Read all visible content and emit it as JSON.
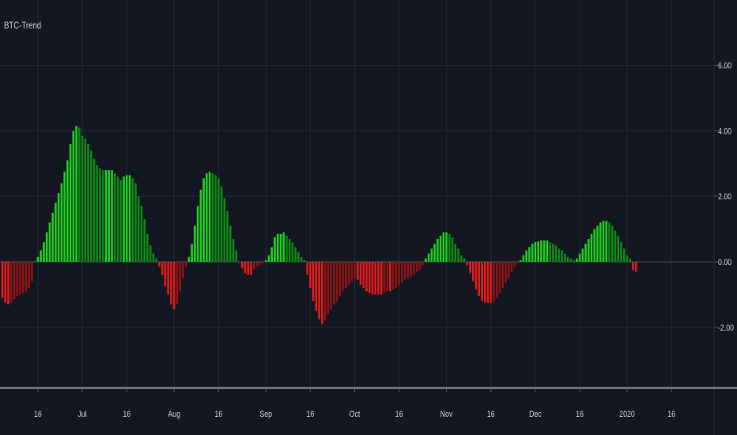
{
  "indicator": {
    "title": "BTC-Trend"
  },
  "colors": {
    "background": "#131722",
    "grid": "#262a36",
    "up_bright": "#1fcf1f",
    "up_dark": "#0e8a12",
    "down_bright": "#e11b1b",
    "down_dark": "#8e1414",
    "axis_text": "#d1d4dc"
  },
  "chart_data": {
    "type": "bar",
    "title": "BTC-Trend",
    "start_date": "2019-06-04",
    "interval": "1 day",
    "ylim": [
      -3.5,
      7.5
    ],
    "grid": true,
    "y_ticks": [
      "6.00",
      "4.00",
      "2.00",
      "0.00",
      "-2.00"
    ],
    "y_tick_values": [
      6,
      4,
      2,
      0,
      -2
    ],
    "x_ticks": [
      {
        "label": "16",
        "date": "2019-06-16"
      },
      {
        "label": "Jul",
        "date": "2019-07-01"
      },
      {
        "label": "16",
        "date": "2019-07-16"
      },
      {
        "label": "Aug",
        "date": "2019-08-01"
      },
      {
        "label": "16",
        "date": "2019-08-16"
      },
      {
        "label": "Sep",
        "date": "2019-09-01"
      },
      {
        "label": "16",
        "date": "2019-09-16"
      },
      {
        "label": "Oct",
        "date": "2019-10-01"
      },
      {
        "label": "16",
        "date": "2019-10-16"
      },
      {
        "label": "Nov",
        "date": "2019-11-01"
      },
      {
        "label": "16",
        "date": "2019-11-16"
      },
      {
        "label": "Dec",
        "date": "2019-12-01"
      },
      {
        "label": "16",
        "date": "2019-12-16"
      },
      {
        "label": "2020",
        "date": "2020-01-01"
      },
      {
        "label": "16",
        "date": "2020-01-16"
      }
    ],
    "values": [
      -1.1,
      -1.25,
      -1.3,
      -1.25,
      -1.15,
      -1.05,
      -1.0,
      -0.95,
      -0.9,
      -0.8,
      -0.6,
      0.02,
      0.15,
      0.35,
      0.6,
      0.9,
      1.2,
      1.5,
      1.8,
      2.1,
      2.4,
      2.75,
      3.1,
      3.6,
      4.0,
      4.15,
      4.1,
      3.85,
      3.75,
      3.6,
      3.4,
      3.15,
      2.95,
      2.85,
      2.8,
      2.8,
      2.8,
      2.8,
      2.7,
      2.6,
      2.5,
      2.6,
      2.65,
      2.65,
      2.55,
      2.4,
      2.0,
      1.7,
      1.3,
      0.85,
      0.5,
      0.25,
      0.1,
      -0.15,
      -0.4,
      -0.75,
      -1.0,
      -1.3,
      -1.45,
      -1.3,
      -0.9,
      -0.5,
      -0.15,
      0.15,
      0.55,
      1.1,
      1.7,
      2.2,
      2.55,
      2.7,
      2.75,
      2.7,
      2.65,
      2.55,
      2.3,
      1.95,
      1.55,
      1.1,
      0.7,
      0.35,
      -0.05,
      -0.2,
      -0.35,
      -0.4,
      -0.4,
      -0.25,
      -0.15,
      -0.1,
      -0.05,
      0.05,
      0.2,
      0.45,
      0.75,
      0.85,
      0.85,
      0.9,
      0.8,
      0.7,
      0.6,
      0.45,
      0.3,
      0.15,
      0.05,
      -0.4,
      -0.8,
      -1.2,
      -1.5,
      -1.75,
      -1.9,
      -1.8,
      -1.6,
      -1.45,
      -1.3,
      -1.2,
      -1.05,
      -0.9,
      -0.8,
      -0.7,
      -0.6,
      -0.5,
      -0.55,
      -0.7,
      -0.8,
      -0.9,
      -0.95,
      -1.0,
      -1.0,
      -1.0,
      -1.0,
      -0.95,
      -0.9,
      -0.9,
      -0.85,
      -0.8,
      -0.7,
      -0.65,
      -0.55,
      -0.5,
      -0.45,
      -0.4,
      -0.3,
      -0.25,
      -0.1,
      0.1,
      0.25,
      0.4,
      0.55,
      0.7,
      0.8,
      0.9,
      0.9,
      0.85,
      0.75,
      0.55,
      0.4,
      0.2,
      0.1,
      -0.1,
      -0.35,
      -0.6,
      -0.85,
      -1.05,
      -1.2,
      -1.25,
      -1.25,
      -1.25,
      -1.2,
      -1.1,
      -0.95,
      -0.8,
      -0.65,
      -0.5,
      -0.3,
      -0.15,
      -0.05,
      0.05,
      0.2,
      0.35,
      0.45,
      0.55,
      0.6,
      0.62,
      0.65,
      0.65,
      0.65,
      0.6,
      0.55,
      0.5,
      0.4,
      0.35,
      0.25,
      0.15,
      0.1,
      0.05,
      0.1,
      0.25,
      0.4,
      0.55,
      0.7,
      0.85,
      1.0,
      1.1,
      1.2,
      1.25,
      1.25,
      1.2,
      1.1,
      0.95,
      0.8,
      0.6,
      0.4,
      0.2,
      0.1,
      -0.25,
      -0.3
    ]
  }
}
